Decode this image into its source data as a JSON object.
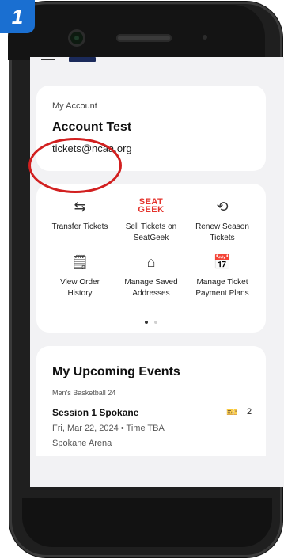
{
  "step_badge": "1",
  "account": {
    "label": "My Account",
    "name": "Account Test",
    "email": "tickets@ncaa.org"
  },
  "actions": [
    {
      "label_line1": "Transfer Tickets",
      "label_line2": "",
      "icon": "transfer-arrows-icon",
      "glyph": "⇆"
    },
    {
      "label_line1": "Sell Tickets on",
      "label_line2": "SeatGeek",
      "icon": "seatgeek-logo",
      "logo_text": "SEAT GEEK"
    },
    {
      "label_line1": "Renew Season",
      "label_line2": "Tickets",
      "icon": "renew-icon",
      "glyph": "⟲"
    },
    {
      "label_line1": "View Order",
      "label_line2": "History",
      "icon": "order-history-icon",
      "glyph": "🗒"
    },
    {
      "label_line1": "Manage Saved",
      "label_line2": "Addresses",
      "icon": "address-book-icon",
      "glyph": "⌂"
    },
    {
      "label_line1": "Manage Ticket",
      "label_line2": "Payment Plans",
      "icon": "payment-calendar-icon",
      "glyph": "📅"
    }
  ],
  "events": {
    "heading": "My Upcoming Events",
    "category": "Men's Basketball 24",
    "title": "Session 1 Spokane",
    "ticket_count": "2",
    "date_time": "Fri, Mar 22, 2024 • Time TBA",
    "venue": "Spokane Arena"
  },
  "colors": {
    "badge": "#1a6fd1",
    "highlight": "#d22020",
    "seatgeek": "#e4322b"
  }
}
